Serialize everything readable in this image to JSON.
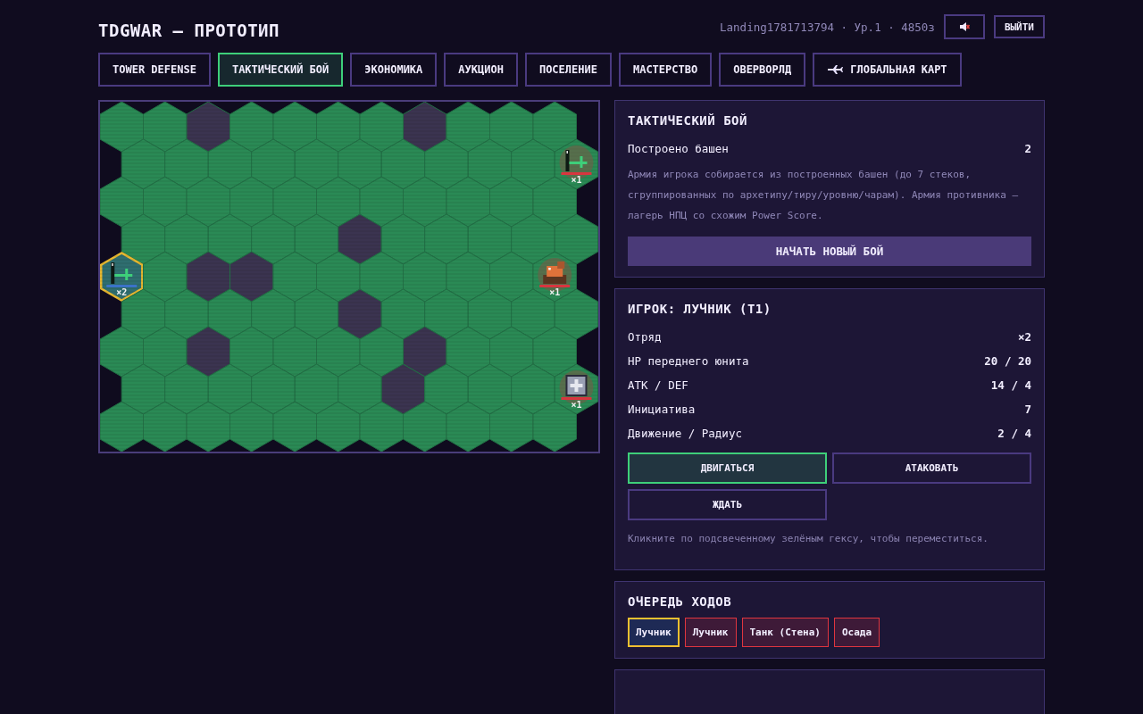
{
  "header": {
    "title": "TDGWAR — ПРОТОТИП",
    "user_info": "Landing1781713794 · Ур.1 · 4850з",
    "muted": true,
    "logout": "ВЫЙТИ"
  },
  "tabs": [
    {
      "label": "TOWER DEFENSE",
      "selected": false
    },
    {
      "label": "ТАКТИЧЕСКИЙ БОЙ",
      "selected": true
    },
    {
      "label": "ЭКОНОМИКА",
      "selected": false
    },
    {
      "label": "АУКЦИОН",
      "selected": false
    },
    {
      "label": "ПОСЕЛЕНИЕ",
      "selected": false
    },
    {
      "label": "МАСТЕРСТВО",
      "selected": false
    },
    {
      "label": "ОВЕРВОРЛД",
      "selected": false
    },
    {
      "label": "ГЛОБАЛЬНАЯ КАРТ",
      "selected": false,
      "kind": "map"
    }
  ],
  "map": {
    "rows": [
      [
        {
          "blocked": false
        },
        {
          "blocked": false
        },
        {
          "blocked": true
        },
        {
          "blocked": false
        },
        {
          "blocked": false
        },
        {
          "blocked": false
        },
        {
          "blocked": false
        },
        {
          "blocked": true
        },
        {
          "blocked": false
        },
        {
          "blocked": false
        },
        {
          "blocked": false
        }
      ],
      [
        {
          "blocked": false
        },
        {
          "blocked": false
        },
        {
          "blocked": false
        },
        {
          "blocked": false
        },
        {
          "blocked": false
        },
        {
          "blocked": false
        },
        {
          "blocked": false
        },
        {
          "blocked": false
        },
        {
          "blocked": false
        },
        {
          "blocked": false
        },
        {
          "blocked": false,
          "unit": {
            "enemy": true,
            "kind": "archer",
            "count": "×1",
            "selected": false
          }
        }
      ],
      [
        {
          "blocked": false
        },
        {
          "blocked": false
        },
        {
          "blocked": false
        },
        {
          "blocked": false
        },
        {
          "blocked": false
        },
        {
          "blocked": false
        },
        {
          "blocked": false
        },
        {
          "blocked": false
        },
        {
          "blocked": false
        },
        {
          "blocked": false
        },
        {
          "blocked": false
        }
      ],
      [
        {
          "blocked": false
        },
        {
          "blocked": false
        },
        {
          "blocked": false
        },
        {
          "blocked": false
        },
        {
          "blocked": false
        },
        {
          "blocked": true
        },
        {
          "blocked": false
        },
        {
          "blocked": false
        },
        {
          "blocked": false
        },
        {
          "blocked": false
        },
        {
          "blocked": false
        }
      ],
      [
        {
          "blocked": false,
          "unit": {
            "enemy": false,
            "kind": "archer",
            "count": "×2",
            "selected": true
          }
        },
        {
          "blocked": false
        },
        {
          "blocked": true
        },
        {
          "blocked": true
        },
        {
          "blocked": false
        },
        {
          "blocked": false
        },
        {
          "blocked": false
        },
        {
          "blocked": false
        },
        {
          "blocked": false
        },
        {
          "blocked": false
        },
        {
          "blocked": false,
          "unit": {
            "enemy": true,
            "kind": "tank",
            "count": "×1",
            "selected": false
          }
        }
      ],
      [
        {
          "blocked": false
        },
        {
          "blocked": false
        },
        {
          "blocked": false
        },
        {
          "blocked": false
        },
        {
          "blocked": false
        },
        {
          "blocked": true
        },
        {
          "blocked": false
        },
        {
          "blocked": false
        },
        {
          "blocked": false
        },
        {
          "blocked": false
        },
        {
          "blocked": false
        }
      ],
      [
        {
          "blocked": false
        },
        {
          "blocked": false
        },
        {
          "blocked": true
        },
        {
          "blocked": false
        },
        {
          "blocked": false
        },
        {
          "blocked": false
        },
        {
          "blocked": false
        },
        {
          "blocked": true
        },
        {
          "blocked": false
        },
        {
          "blocked": false
        },
        {
          "blocked": false
        }
      ],
      [
        {
          "blocked": false
        },
        {
          "blocked": false
        },
        {
          "blocked": false
        },
        {
          "blocked": false
        },
        {
          "blocked": false
        },
        {
          "blocked": false
        },
        {
          "blocked": true
        },
        {
          "blocked": false
        },
        {
          "blocked": false
        },
        {
          "blocked": false
        },
        {
          "blocked": false,
          "unit": {
            "enemy": true,
            "kind": "siege",
            "count": "×1",
            "selected": false
          }
        }
      ],
      [
        {
          "blocked": false
        },
        {
          "blocked": false
        },
        {
          "blocked": false
        },
        {
          "blocked": false
        },
        {
          "blocked": false
        },
        {
          "blocked": false
        },
        {
          "blocked": false
        },
        {
          "blocked": false
        },
        {
          "blocked": false
        },
        {
          "blocked": false
        },
        {
          "blocked": false
        }
      ]
    ]
  },
  "battle_panel": {
    "title": "ТАКТИЧЕСКИЙ БОЙ",
    "stat_label": "Построено башен",
    "stat_value": "2",
    "description": "Армия игрока собирается из построенных башен (до 7 стеков, сгруппированных по архетипу/тиру/уровню/чарам). Армия противника — лагерь НПЦ со схожим Power Score.",
    "start_button": "НАЧАТЬ НОВЫЙ БОЙ"
  },
  "unit_panel": {
    "title": "ИГРОК: ЛУЧНИК (T1)",
    "stats": [
      {
        "label": "Отряд",
        "value": "×2"
      },
      {
        "label": "HP переднего юнита",
        "value": "20 / 20"
      },
      {
        "label": "ATK / DEF",
        "value": "14 / 4"
      },
      {
        "label": "Инициатива",
        "value": "7"
      },
      {
        "label": "Движение / Радиус",
        "value": "2 / 4"
      }
    ],
    "actions": [
      {
        "label": "ДВИГАТЬСЯ",
        "selected": true
      },
      {
        "label": "АТАКОВАТЬ",
        "selected": false
      },
      {
        "label": "ЖДАТЬ",
        "selected": false
      }
    ],
    "hint": "Кликните по подсвеченному зелёным гексу, чтобы переместиться."
  },
  "turn_queue": {
    "title": "ОЧЕРЕДЬ ХОДОВ",
    "items": [
      {
        "label": "Лучник",
        "enemy": false,
        "selected": true
      },
      {
        "label": "Лучник",
        "enemy": true,
        "selected": false
      },
      {
        "label": "Танк (Стена)",
        "enemy": true,
        "selected": false
      },
      {
        "label": "Осада",
        "enemy": true,
        "selected": false
      }
    ]
  }
}
